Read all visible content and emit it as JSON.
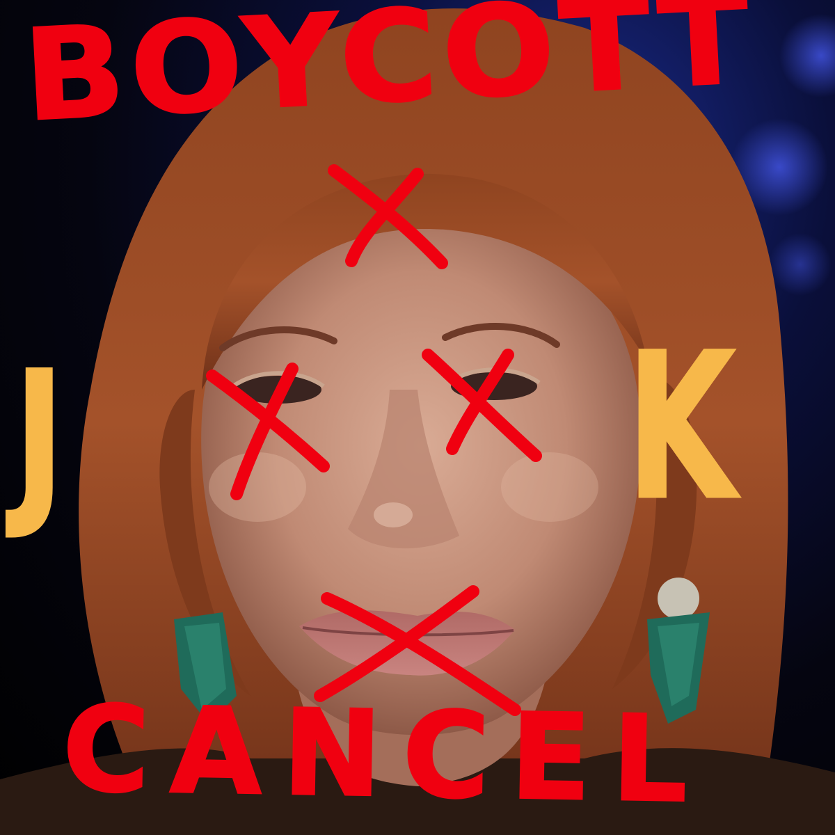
{
  "overlay": {
    "top_text": "BOYCOTT",
    "bottom_text": "CANCEL",
    "initial_left": "J",
    "initial_right": "K"
  },
  "colors": {
    "scrawl_red": "#f00010",
    "initials_yellow": "#f7b84a",
    "background_blue": "#1a2a8a",
    "hair": "#9a4a24",
    "skin": "#c99a84",
    "earring_green": "#1f6b5a"
  }
}
